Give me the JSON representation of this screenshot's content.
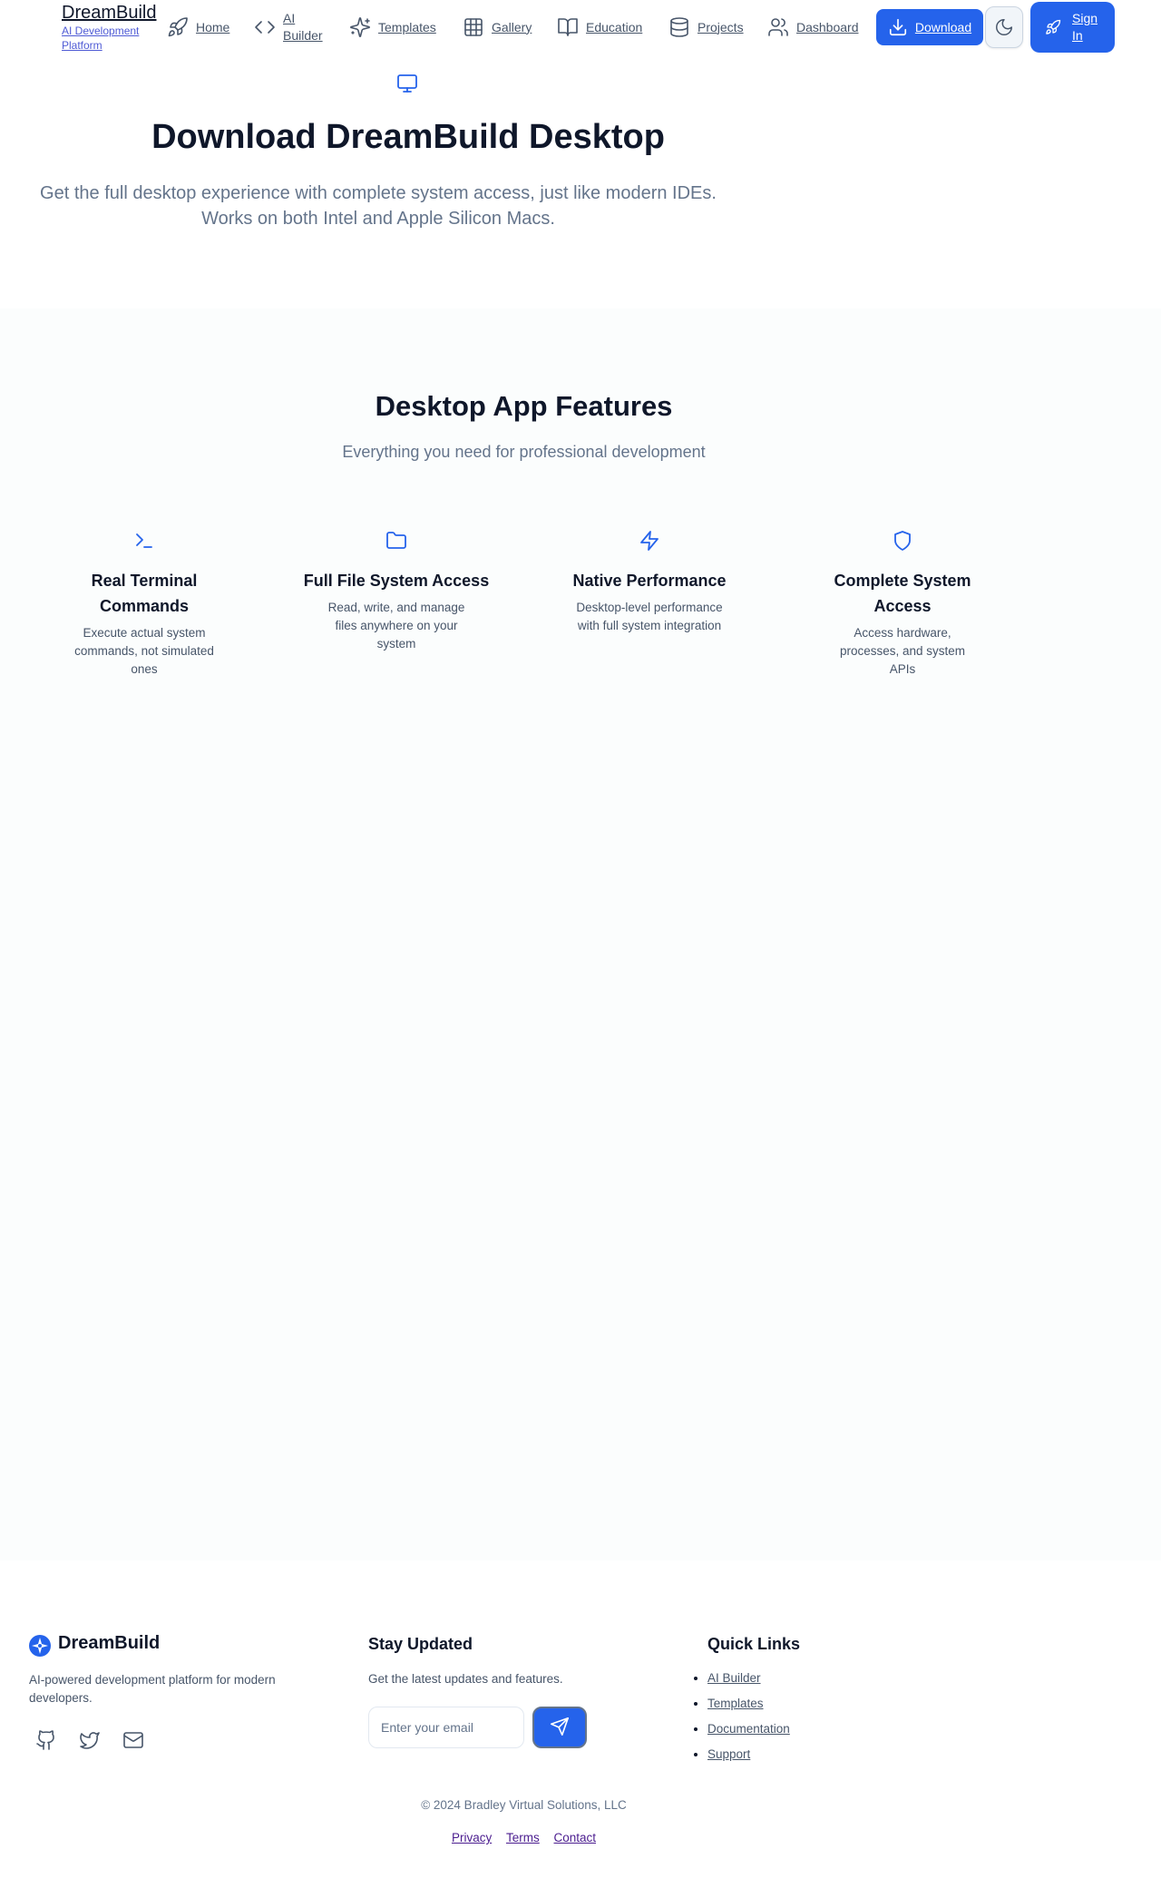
{
  "navbar": {
    "brand": "DreamBuild",
    "brand_sub": "AI Development Platform",
    "items": [
      {
        "label": "Home",
        "icon": "rocket-icon"
      },
      {
        "label": "AI Builder",
        "icon": "code-icon"
      },
      {
        "label": "Templates",
        "icon": "sparkles-icon"
      },
      {
        "label": "Gallery",
        "icon": "grid-icon"
      },
      {
        "label": "Education",
        "icon": "book-icon"
      },
      {
        "label": "Projects",
        "icon": "database-icon"
      },
      {
        "label": "Dashboard",
        "icon": "users-icon"
      }
    ],
    "download_label": "Download",
    "theme_icon": "moon-icon",
    "signin_label": "Sign In"
  },
  "hero": {
    "icon": "monitor-icon",
    "title": "Download DreamBuild Desktop",
    "subtitle": "Get the full desktop experience with complete system access, just like modern IDEs. Works on both Intel and Apple Silicon Macs."
  },
  "features": {
    "title": "Desktop App Features",
    "subtitle": "Everything you need for professional development",
    "items": [
      {
        "icon": "terminal-icon",
        "title": "Real Terminal Commands",
        "desc": "Execute actual system commands, not simulated ones"
      },
      {
        "icon": "folder-icon",
        "title": "Full File System Access",
        "desc": "Read, write, and manage files anywhere on your system"
      },
      {
        "icon": "zap-icon",
        "title": "Native Performance",
        "desc": "Desktop-level performance with full system integration"
      },
      {
        "icon": "shield-icon",
        "title": "Complete System Access",
        "desc": "Access hardware, processes, and system APIs"
      }
    ]
  },
  "footer": {
    "brand": "DreamBuild",
    "description": "AI-powered development platform for modern developers.",
    "stay_title": "Stay Updated",
    "stay_desc": "Get the latest updates and features.",
    "email_placeholder": "Enter your email",
    "quick_title": "Quick Links",
    "quick_links": [
      "AI Builder",
      "Templates",
      "Documentation",
      "Support"
    ],
    "copyright": "© 2024 Bradley Virtual Solutions, LLC",
    "legal": [
      "Privacy",
      "Terms",
      "Contact"
    ]
  },
  "colors": {
    "accent": "#2563eb",
    "text": "#0f172a",
    "muted": "#64748b"
  }
}
